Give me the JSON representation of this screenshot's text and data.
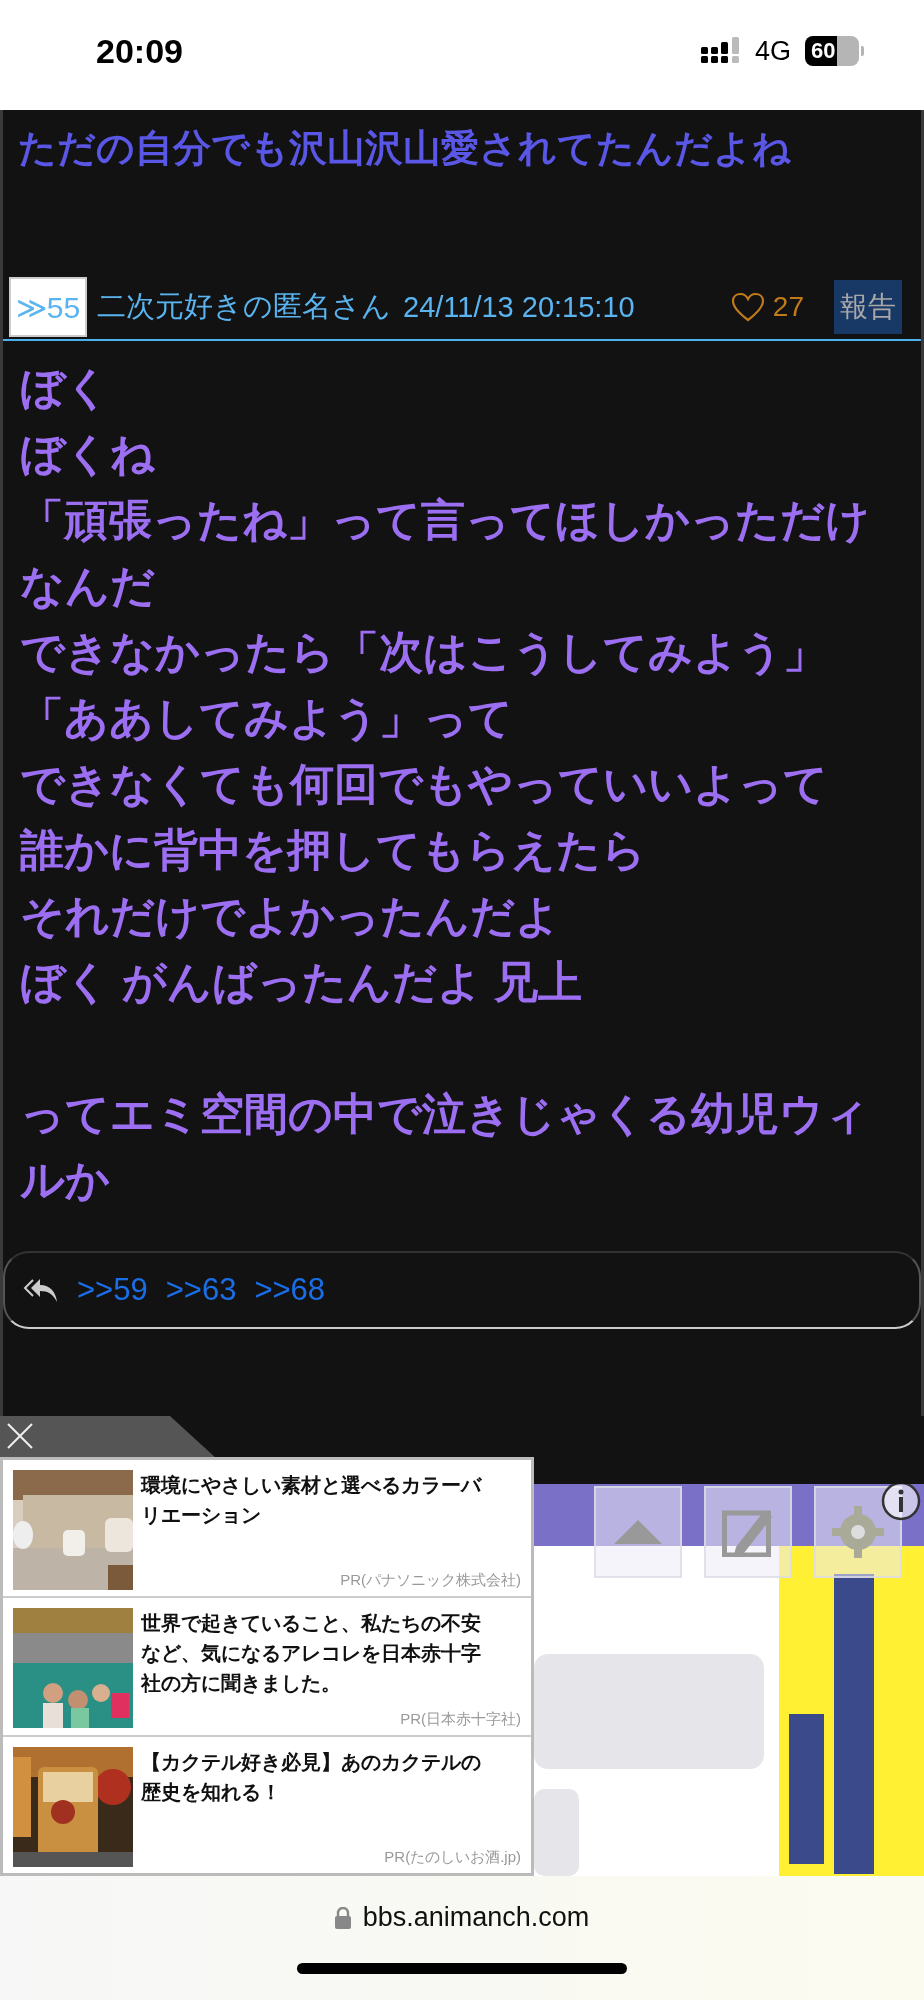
{
  "status_bar": {
    "time": "20:09",
    "network": "4G",
    "battery": "60"
  },
  "previous_post": {
    "last_line": "ただの自分でも沢山沢山愛されてたんだよね"
  },
  "post": {
    "number": "≫55",
    "author": "二次元好きの匿名さん",
    "date": "24/11/13 20:15:10",
    "likes": "27",
    "liked": false,
    "report": "報告",
    "paragraphs": [
      [
        "ぼく",
        "ぼくね",
        "「頑張ったね」って言ってほしかっただけなんだ",
        "できなかったら「次はこうしてみよう」",
        "「ああしてみよう」って",
        "できなくても何回でもやっていいよって",
        "誰かに背中を押してもらえたら",
        "それだけでよかったんだよ",
        "ぼく がんばったんだよ 兄上"
      ],
      [
        "ってエミ空間の中で泣きじゃくる幼児ウィルか"
      ]
    ],
    "replies": [
      ">>59",
      ">>63",
      ">>68"
    ]
  },
  "ads": {
    "items": [
      {
        "title": "環境にやさしい素材と選べるカラーバリエーション",
        "sponsor": "PR(パナソニック株式会社)"
      },
      {
        "title": "世界で起きていること、私たちの不安など、気になるアレコレを日本赤十字社の方に聞きました。",
        "sponsor": "PR(日本赤十字社)"
      },
      {
        "title": "【カクテル好き必見】あのカクテルの歴史を知れる！",
        "sponsor": "PR(たのしいお酒.jp)"
      }
    ]
  },
  "browser": {
    "url": "bbs.animanch.com"
  }
}
